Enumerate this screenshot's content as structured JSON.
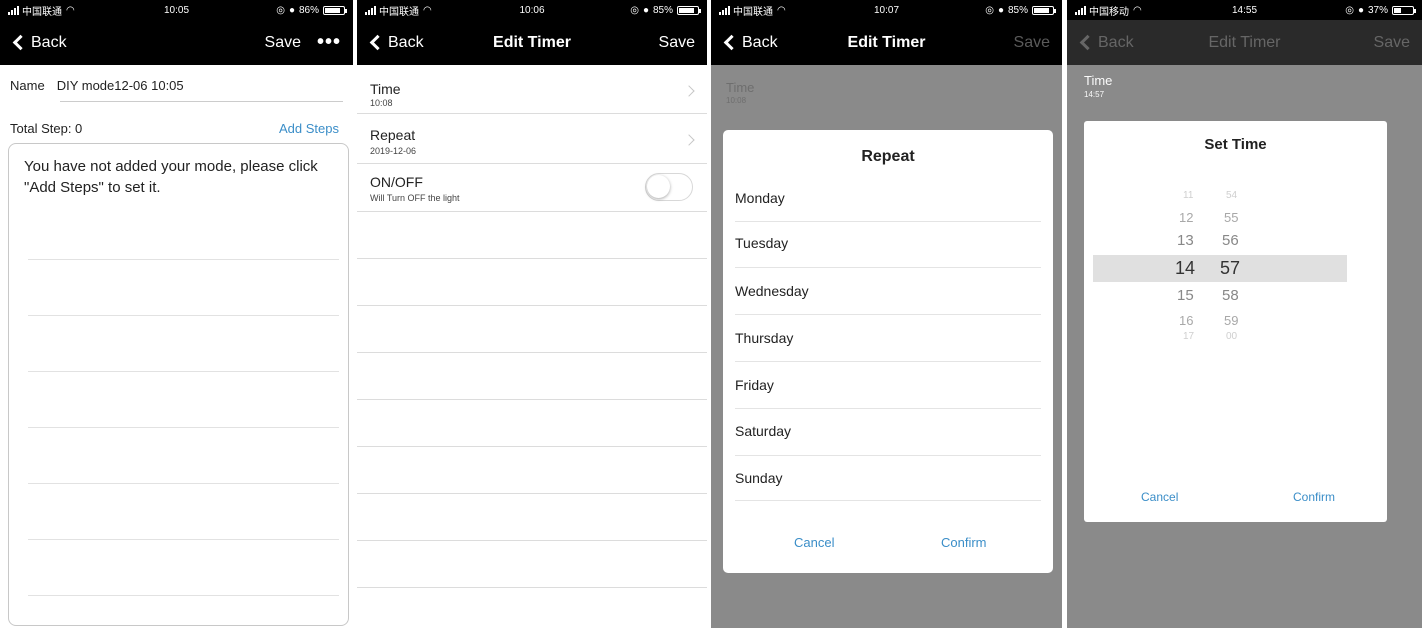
{
  "screens": [
    {
      "status": {
        "carrier": "中国联通",
        "time": "10:05",
        "battery": "86%",
        "battery_level": 0.86
      },
      "nav": {
        "back": "Back",
        "save": "Save",
        "more": "•••"
      },
      "name_label": "Name",
      "name_value": "DIY mode12-06 10:05",
      "total_steps": "Total Step: 0",
      "add_steps": "Add Steps",
      "empty_message": "You have not added your mode, please click \"Add Steps\" to set it."
    },
    {
      "status": {
        "carrier": "中国联通",
        "time": "10:06",
        "battery": "85%",
        "battery_level": 0.85
      },
      "nav": {
        "back": "Back",
        "title": "Edit Timer",
        "save": "Save"
      },
      "rows": [
        {
          "label": "Time",
          "sub": "10:08"
        },
        {
          "label": "Repeat",
          "sub": "2019-12-06"
        },
        {
          "label": "ON/OFF",
          "sub": "Will Turn OFF the light"
        }
      ]
    },
    {
      "status": {
        "carrier": "中国联通",
        "time": "10:07",
        "battery": "85%",
        "battery_level": 0.85
      },
      "nav": {
        "back": "Back",
        "title": "Edit Timer",
        "save": "Save"
      },
      "bg_row": {
        "label": "Time",
        "sub": "10:08"
      },
      "dialog": {
        "title": "Repeat",
        "days": [
          "Monday",
          "Tuesday",
          "Wednesday",
          "Thursday",
          "Friday",
          "Saturday",
          "Sunday"
        ],
        "cancel": "Cancel",
        "confirm": "Confirm"
      }
    },
    {
      "status": {
        "carrier": "中国移动",
        "time": "14:55",
        "battery": "37%",
        "battery_level": 0.37
      },
      "nav": {
        "back": "Back",
        "title": "Edit Timer",
        "save": "Save"
      },
      "bg_row": {
        "label": "Time",
        "sub": "14:57"
      },
      "dialog": {
        "title": "Set Time",
        "hours": [
          "11",
          "12",
          "13",
          "14",
          "15",
          "16",
          "17"
        ],
        "minutes": [
          "54",
          "55",
          "56",
          "57",
          "58",
          "59",
          "00"
        ],
        "selected_hour": "14",
        "selected_minute": "57",
        "cancel": "Cancel",
        "confirm": "Confirm"
      }
    }
  ]
}
